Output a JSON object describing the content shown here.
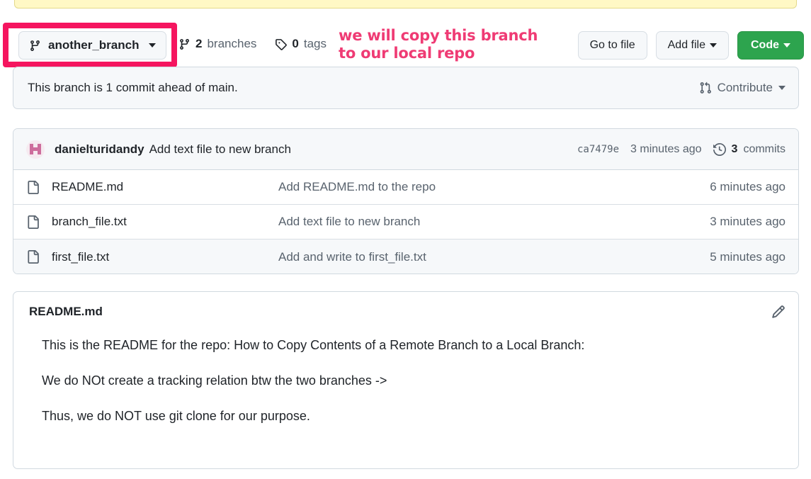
{
  "banner": {
    "present": true,
    "color": "#fff8c5"
  },
  "branch_bar": {
    "current_branch": "another_branch",
    "branches_count": "2",
    "branches_label": "branches",
    "tags_count": "0",
    "tags_label": "tags",
    "annotation": "we will copy this branch\nto our local repo",
    "annotation_color": "#ef3b74",
    "highlight_color": "#f5155f",
    "go_to_file_label": "Go to file",
    "add_file_label": "Add file",
    "code_label": "Code",
    "code_button_color": "#2da44e"
  },
  "ahead_panel": {
    "text": "This branch is 1 commit ahead of main.",
    "contribute_label": "Contribute"
  },
  "commit_header": {
    "author": "danielturidandy",
    "message": "Add text file to new branch",
    "sha": "ca7479e",
    "time": "3 minutes ago",
    "commits_count": "3",
    "commits_label": "commits"
  },
  "files": [
    {
      "name": "README.md",
      "message": "Add README.md to the repo",
      "time": "6 minutes ago",
      "hovered": false
    },
    {
      "name": "branch_file.txt",
      "message": "Add text file to new branch",
      "time": "3 minutes ago",
      "hovered": false
    },
    {
      "name": "first_file.txt",
      "message": "Add and write to first_file.txt",
      "time": "5 minutes ago",
      "hovered": true
    }
  ],
  "readme": {
    "title": "README.md",
    "paragraphs": [
      "This is the README for the repo: How to Copy Contents of a Remote Branch to a Local Branch:",
      "We do NOt create a tracking relation btw the two branches ->",
      "Thus, we do NOT use git clone for our purpose."
    ]
  }
}
